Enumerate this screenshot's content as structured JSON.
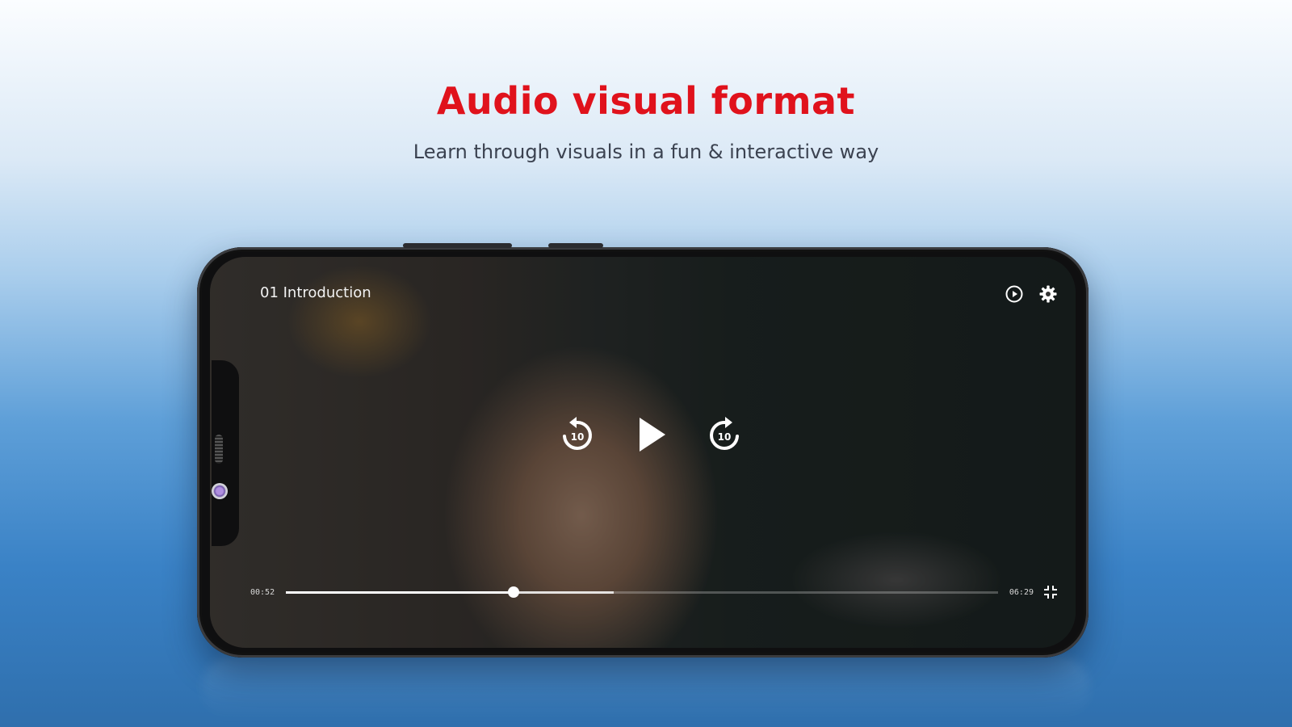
{
  "banner": {
    "headline": "Audio visual format",
    "subhead": "Learn through visuals in a fun & interactive way",
    "headline_color": "#e0121c"
  },
  "player": {
    "title": "01 Introduction",
    "current_time": "00:52",
    "duration": "06:29",
    "played_fraction": 0.32,
    "buffered_fraction": 0.46,
    "rewind_seconds": "10",
    "forward_seconds": "10",
    "icons": {
      "speed": "playback-speed-icon",
      "settings": "gear-icon",
      "rewind": "replay-10-icon",
      "play": "play-icon",
      "forward": "forward-10-icon",
      "fullscreen": "exit-fullscreen-icon"
    }
  }
}
